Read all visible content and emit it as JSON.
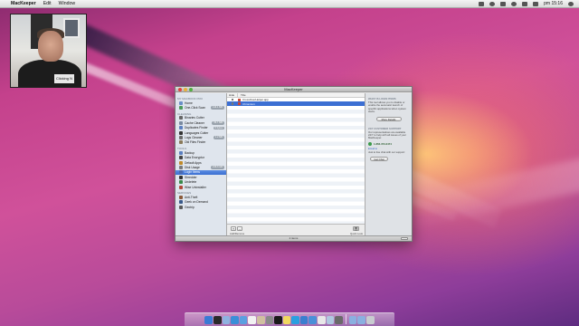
{
  "menubar": {
    "apple_glyph": "",
    "app_name": "MacKeeper",
    "menus": [
      "Edit",
      "Window"
    ],
    "clock": "pm 15:16"
  },
  "webcam": {
    "shirt_text": "Clicking N"
  },
  "window": {
    "title": "MacKeeper",
    "sidebar": {
      "groups": [
        {
          "label": "MY MACBOOK PRO",
          "items": [
            {
              "label": "Home",
              "color": "#6a8fc7"
            },
            {
              "label": "One-Click Scan",
              "color": "#4c9a5a",
              "badge": "113.1 MB"
            }
          ]
        },
        {
          "label": "CLEANING",
          "items": [
            {
              "label": "Binaries Cutter",
              "color": "#666666"
            },
            {
              "label": "Cache Cleaner",
              "color": "#7a8aa0",
              "badge": "56.7 MB"
            },
            {
              "label": "Duplicates Finder",
              "color": "#5b7fbf",
              "badge": "0 bytes"
            },
            {
              "label": "Languages Cutter",
              "color": "#333333"
            },
            {
              "label": "Logs Cleaner",
              "color": "#6a6a6a",
              "badge": "1.2 MB"
            },
            {
              "label": "Old Files Finder",
              "color": "#8a7a5a"
            }
          ]
        },
        {
          "label": "TOOLS",
          "items": [
            {
              "label": "Backup",
              "color": "#5a7fbf"
            },
            {
              "label": "Data Encryptor",
              "color": "#444444"
            },
            {
              "label": "Default Apps",
              "color": "#c08a2a"
            },
            {
              "label": "Disk Usage",
              "color": "#7a7a7a",
              "badge": "216.6 GB"
            },
            {
              "label": "Login Items",
              "color": "#4a6ab0",
              "selected": true
            },
            {
              "label": "Shredder",
              "color": "#333333"
            },
            {
              "label": "Undelete",
              "color": "#3a8a4a"
            },
            {
              "label": "Wise Uninstaller",
              "color": "#b04a3a"
            }
          ]
        },
        {
          "label": "SERVICES",
          "items": [
            {
              "label": "Anti-Theft",
              "color": "#8a5a3a"
            },
            {
              "label": "Geek on Demand",
              "color": "#3a5a8a"
            },
            {
              "label": "Geotrip",
              "color": "#5a5a5a"
            }
          ]
        }
      ]
    },
    "table": {
      "headers": [
        "Hide",
        "Title"
      ],
      "rows": [
        {
          "title": "CrossOverHelper.app",
          "selected": false
        },
        {
          "title": "Chromium",
          "selected": true
        }
      ],
      "footer": {
        "add_label": "+",
        "remove_label": "-",
        "add_remove_caption": "Add/Remove",
        "quick_look_glyph": "👁",
        "quick_look_caption": "Quick Look"
      }
    },
    "right_panel": {
      "login_heading": "WHAT IS LOGIN ITEMS",
      "login_text": "This tool allows you to disable or enable the automatic launch of specific applications when system starts.",
      "more_button": "More Details",
      "support_heading": "24/7 CUSTOMER SUPPORT",
      "support_text": "Our representatives are available 24/7 to help with all issues of your MacKeeper.",
      "phone": "1-866-373-3474",
      "email_link": "Email to",
      "chat_text": "Just to live chat with our support:",
      "chat_button": "Get Chat"
    },
    "status": "2 items"
  },
  "dock": {
    "apps": [
      "finder",
      "dashboard",
      "mail",
      "safari",
      "itunes",
      "calendar",
      "photos",
      "system-preferences",
      "terminal",
      "notes",
      "skype",
      "app-store",
      "mackeeper",
      "textedit",
      "preview",
      "utilities"
    ],
    "right": [
      "documents-folder",
      "downloads-folder",
      "trash"
    ],
    "colors": {
      "finder": "#3a7bd5",
      "dashboard": "#2a2a2a",
      "mail": "#8fb3e0",
      "safari": "#3a8fd8",
      "itunes": "#5aa0e0",
      "calendar": "#f2f2f2",
      "photos": "#d0c0a0",
      "system-preferences": "#8a8a8a",
      "terminal": "#1a1a1a",
      "notes": "#f0d860",
      "skype": "#2aa0e0",
      "app-store": "#3a7fd0",
      "mackeeper": "#4a90d8",
      "textedit": "#e8e8e8",
      "preview": "#b0c8e0",
      "utilities": "#6a6a6a",
      "documents-folder": "#8ab0e0",
      "downloads-folder": "#8ab0e0",
      "trash": "#c8ccd0"
    }
  }
}
